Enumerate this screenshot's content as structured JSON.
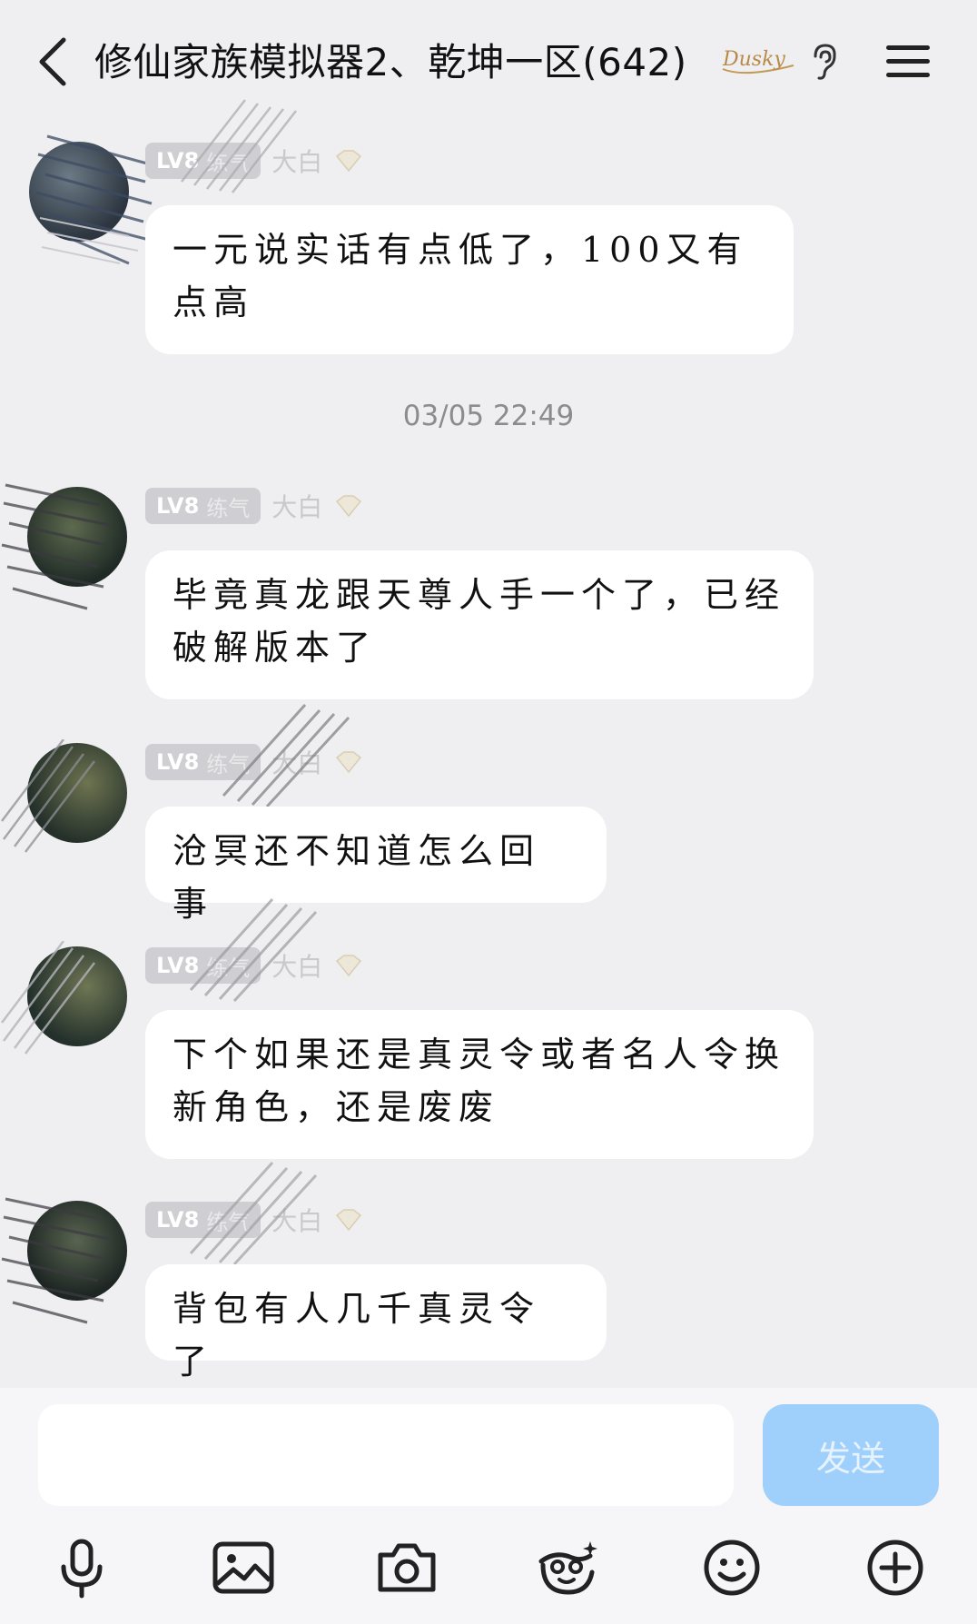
{
  "header": {
    "title": "修仙家族模拟器2、乾坤一区(642)",
    "brand_text": "Dusky"
  },
  "messages": [
    {
      "level": "LV8",
      "rank": "练气",
      "nickname": "大白",
      "text": "一元说实话有点低了，100又有点高"
    },
    {
      "level": "LV8",
      "rank": "练气",
      "nickname": "大白",
      "text": "毕竟真龙跟天尊人手一个了，已经破解版本了"
    },
    {
      "level": "LV8",
      "rank": "练气",
      "nickname": "大白",
      "text": "沧冥还不知道怎么回事"
    },
    {
      "level": "LV8",
      "rank": "练气",
      "nickname": "大白",
      "text": "下个如果还是真灵令或者名人令换新角色，还是废废"
    },
    {
      "level": "LV8",
      "rank": "练气",
      "nickname": "大白",
      "text": "背包有人几千真灵令了"
    }
  ],
  "timestamp": "03/05 22:49",
  "composer": {
    "input_value": "",
    "send_label": "发送"
  },
  "toolbar": [
    "microphone-icon",
    "image-icon",
    "camera-icon",
    "sticker-icon",
    "emoji-icon",
    "plus-icon"
  ],
  "colors": {
    "background": "#efeff1",
    "bubble": "#ffffff",
    "send": "#9fd0fb"
  }
}
